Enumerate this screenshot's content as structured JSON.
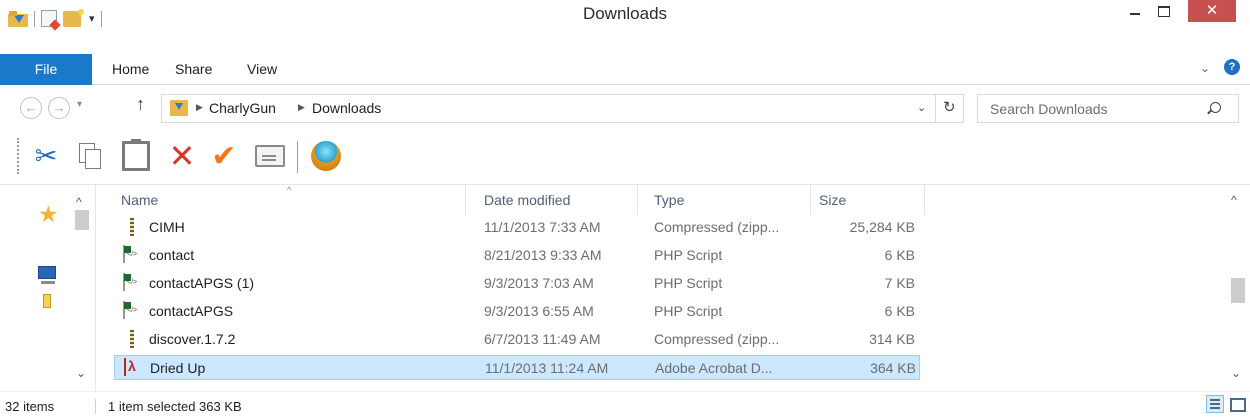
{
  "window": {
    "title": "Downloads",
    "close_glyph": "✕"
  },
  "quick_access": {
    "dropdown_glyph": "▾"
  },
  "ribbon": {
    "file_tab": "File",
    "tabs": [
      "Home",
      "Share",
      "View"
    ],
    "expand_glyph": "⌄",
    "help_glyph": "?"
  },
  "address": {
    "back_glyph": "←",
    "forward_glyph": "→",
    "recent_glyph": "▾",
    "up_glyph": "↑",
    "breadcrumbs": [
      "CharlyGun",
      "Downloads"
    ],
    "crumb_separator": "▶",
    "dropdown_glyph": "⌄",
    "refresh_glyph": "↻",
    "search_placeholder": "Search Downloads"
  },
  "toolbar": {
    "cut_glyph": "✂",
    "delete_glyph": "✕",
    "check_glyph": "✔"
  },
  "navpane": {
    "favorites_glyph": "★",
    "scroll_up_glyph": "^",
    "scroll_down_glyph": "⌄"
  },
  "columns": {
    "name": "Name",
    "date": "Date modified",
    "type": "Type",
    "size": "Size",
    "sort_glyph": "^"
  },
  "files": [
    {
      "name": "CIMH",
      "date": "11/1/2013 7:33 AM",
      "type": "Compressed (zipp...",
      "size": "25,284 KB",
      "icon": "zip-folder-icon"
    },
    {
      "name": "contact",
      "date": "8/21/2013 9:33 AM",
      "type": "PHP Script",
      "size": "6 KB",
      "icon": "php-file-icon"
    },
    {
      "name": "contactAPGS (1)",
      "date": "9/3/2013 7:03 AM",
      "type": "PHP Script",
      "size": "7 KB",
      "icon": "php-file-icon"
    },
    {
      "name": "contactAPGS",
      "date": "9/3/2013 6:55 AM",
      "type": "PHP Script",
      "size": "6 KB",
      "icon": "php-file-icon"
    },
    {
      "name": "discover.1.7.2",
      "date": "6/7/2013 11:49 AM",
      "type": "Compressed (zipp...",
      "size": "314 KB",
      "icon": "zip-folder-icon"
    },
    {
      "name": "Dried Up",
      "date": "11/1/2013 11:24 AM",
      "type": "Adobe Acrobat D...",
      "size": "364 KB",
      "icon": "pdf-file-icon",
      "selected": true
    }
  ],
  "list_scroll": {
    "up_glyph": "^",
    "down_glyph": "⌄"
  },
  "status": {
    "item_count": "32 items",
    "selection": "1 item selected  363 KB"
  },
  "colors": {
    "accent": "#1979ca",
    "close": "#c75050",
    "selection_bg": "#cce8ff",
    "selection_border": "#99d1ff",
    "column_header_text": "#4c607a"
  }
}
